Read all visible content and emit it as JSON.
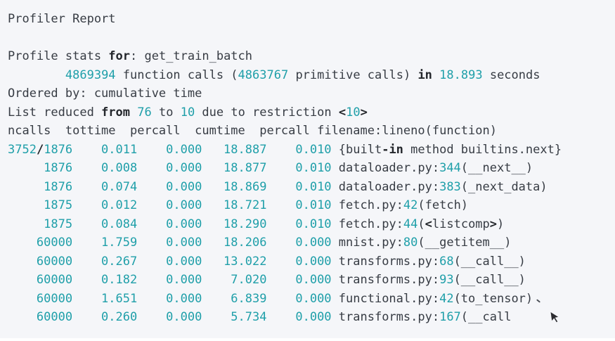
{
  "colors": {
    "page_background": "#ffffff",
    "panel_background": "#f5f6f9",
    "text": "#373c44",
    "keyword": "#23262b",
    "number": "#1f9fa9",
    "cursor": "#2b2b30"
  },
  "report": {
    "title": "Profiler Report",
    "profiled_action": "get_train_batch",
    "total_function_calls": "4869394",
    "primitive_calls": "4863767",
    "total_seconds": "18.893",
    "ordered_by": "cumulative time",
    "list_reduced_from": "76",
    "list_reduced_to": "10",
    "restriction": "10",
    "lines": [
      {
        "name": "report-title",
        "segments": [
          [
            "Profiler Report",
            "p"
          ]
        ]
      },
      {
        "name": "blank-line",
        "segments": []
      },
      {
        "name": "profile-stats-line",
        "segments": [
          [
            "Profile stats ",
            "p"
          ],
          [
            "for",
            "k"
          ],
          [
            ": get_train_batch",
            "p"
          ]
        ]
      },
      {
        "name": "function-calls-line",
        "segments": [
          [
            "        ",
            "p"
          ],
          [
            "4869394",
            "n"
          ],
          [
            " function calls (",
            "p"
          ],
          [
            "4863767",
            "n"
          ],
          [
            " primitive calls) ",
            "p"
          ],
          [
            "in",
            "k"
          ],
          [
            " ",
            "p"
          ],
          [
            "18.893",
            "n"
          ],
          [
            " seconds",
            "p"
          ]
        ]
      },
      {
        "name": "ordered-by-line",
        "segments": [
          [
            "Ordered by: cumulative time",
            "p"
          ]
        ]
      },
      {
        "name": "list-reduced-line",
        "segments": [
          [
            "List reduced ",
            "p"
          ],
          [
            "from",
            "k"
          ],
          [
            " ",
            "p"
          ],
          [
            "76",
            "n"
          ],
          [
            " to ",
            "p"
          ],
          [
            "10",
            "n"
          ],
          [
            " due to restriction ",
            "p"
          ],
          [
            "<",
            "k"
          ],
          [
            "10",
            "n"
          ],
          [
            ">",
            "k"
          ]
        ]
      },
      {
        "name": "table-header-line",
        "segments": [
          [
            "ncalls  tottime  percall  cumtime  percall filename:lineno(function)",
            "p"
          ]
        ]
      }
    ],
    "table_rows": [
      {
        "ncalls": [
          [
            "3752",
            "n"
          ],
          [
            "/",
            "k"
          ],
          [
            "1876",
            "n"
          ]
        ],
        "tottime": [
          [
            "0.011",
            "n"
          ]
        ],
        "percall": [
          [
            "0.000",
            "n"
          ]
        ],
        "cumtime": [
          [
            "18.887",
            "n"
          ]
        ],
        "percall_cum": [
          [
            "0.010",
            "n"
          ]
        ],
        "func": [
          [
            "{built",
            "p"
          ],
          [
            "-in",
            "k"
          ],
          [
            " method builtins.next}",
            "p"
          ]
        ]
      },
      {
        "ncalls": [
          [
            "1876",
            "n"
          ]
        ],
        "tottime": [
          [
            "0.008",
            "n"
          ]
        ],
        "percall": [
          [
            "0.000",
            "n"
          ]
        ],
        "cumtime": [
          [
            "18.877",
            "n"
          ]
        ],
        "percall_cum": [
          [
            "0.010",
            "n"
          ]
        ],
        "func": [
          [
            "dataloader.py:",
            "p"
          ],
          [
            "344",
            "n"
          ],
          [
            "(__next__)",
            "p"
          ]
        ]
      },
      {
        "ncalls": [
          [
            "1876",
            "n"
          ]
        ],
        "tottime": [
          [
            "0.074",
            "n"
          ]
        ],
        "percall": [
          [
            "0.000",
            "n"
          ]
        ],
        "cumtime": [
          [
            "18.869",
            "n"
          ]
        ],
        "percall_cum": [
          [
            "0.010",
            "n"
          ]
        ],
        "func": [
          [
            "dataloader.py:",
            "p"
          ],
          [
            "383",
            "n"
          ],
          [
            "(_next_data)",
            "p"
          ]
        ]
      },
      {
        "ncalls": [
          [
            "1875",
            "n"
          ]
        ],
        "tottime": [
          [
            "0.012",
            "n"
          ]
        ],
        "percall": [
          [
            "0.000",
            "n"
          ]
        ],
        "cumtime": [
          [
            "18.721",
            "n"
          ]
        ],
        "percall_cum": [
          [
            "0.010",
            "n"
          ]
        ],
        "func": [
          [
            "fetch.py:",
            "p"
          ],
          [
            "42",
            "n"
          ],
          [
            "(fetch)",
            "p"
          ]
        ]
      },
      {
        "ncalls": [
          [
            "1875",
            "n"
          ]
        ],
        "tottime": [
          [
            "0.084",
            "n"
          ]
        ],
        "percall": [
          [
            "0.000",
            "n"
          ]
        ],
        "cumtime": [
          [
            "18.290",
            "n"
          ]
        ],
        "percall_cum": [
          [
            "0.010",
            "n"
          ]
        ],
        "func": [
          [
            "fetch.py:",
            "p"
          ],
          [
            "44",
            "n"
          ],
          [
            "(",
            "p"
          ],
          [
            "<",
            "k"
          ],
          [
            "listcomp",
            "p"
          ],
          [
            ">",
            "k"
          ],
          [
            ")",
            "p"
          ]
        ]
      },
      {
        "ncalls": [
          [
            "60000",
            "n"
          ]
        ],
        "tottime": [
          [
            "1.759",
            "n"
          ]
        ],
        "percall": [
          [
            "0.000",
            "n"
          ]
        ],
        "cumtime": [
          [
            "18.206",
            "n"
          ]
        ],
        "percall_cum": [
          [
            "0.000",
            "n"
          ]
        ],
        "func": [
          [
            "mnist.py:",
            "p"
          ],
          [
            "80",
            "n"
          ],
          [
            "(__getitem__)",
            "p"
          ]
        ]
      },
      {
        "ncalls": [
          [
            "60000",
            "n"
          ]
        ],
        "tottime": [
          [
            "0.267",
            "n"
          ]
        ],
        "percall": [
          [
            "0.000",
            "n"
          ]
        ],
        "cumtime": [
          [
            "13.022",
            "n"
          ]
        ],
        "percall_cum": [
          [
            "0.000",
            "n"
          ]
        ],
        "func": [
          [
            "transforms.py:",
            "p"
          ],
          [
            "68",
            "n"
          ],
          [
            "(__call__)",
            "p"
          ]
        ]
      },
      {
        "ncalls": [
          [
            "60000",
            "n"
          ]
        ],
        "tottime": [
          [
            "0.182",
            "n"
          ]
        ],
        "percall": [
          [
            "0.000",
            "n"
          ]
        ],
        "cumtime": [
          [
            "7.020",
            "n"
          ]
        ],
        "percall_cum": [
          [
            "0.000",
            "n"
          ]
        ],
        "func": [
          [
            "transforms.py:",
            "p"
          ],
          [
            "93",
            "n"
          ],
          [
            "(__call__)",
            "p"
          ]
        ]
      },
      {
        "ncalls": [
          [
            "60000",
            "n"
          ]
        ],
        "tottime": [
          [
            "1.651",
            "n"
          ]
        ],
        "percall": [
          [
            "0.000",
            "n"
          ]
        ],
        "cumtime": [
          [
            "6.839",
            "n"
          ]
        ],
        "percall_cum": [
          [
            "0.000",
            "n"
          ]
        ],
        "func": [
          [
            "functional.py:",
            "p"
          ],
          [
            "42",
            "n"
          ],
          [
            "(to_tensor)",
            "p"
          ]
        ]
      },
      {
        "ncalls": [
          [
            "60000",
            "n"
          ]
        ],
        "tottime": [
          [
            "0.260",
            "n"
          ]
        ],
        "percall": [
          [
            "0.000",
            "n"
          ]
        ],
        "cumtime": [
          [
            "5.734",
            "n"
          ]
        ],
        "percall_cum": [
          [
            "0.000",
            "n"
          ]
        ],
        "func": [
          [
            "transforms.py:",
            "p"
          ],
          [
            "167",
            "n"
          ],
          [
            "(__call",
            "p"
          ]
        ]
      }
    ]
  },
  "cursor": {
    "visible": true
  }
}
